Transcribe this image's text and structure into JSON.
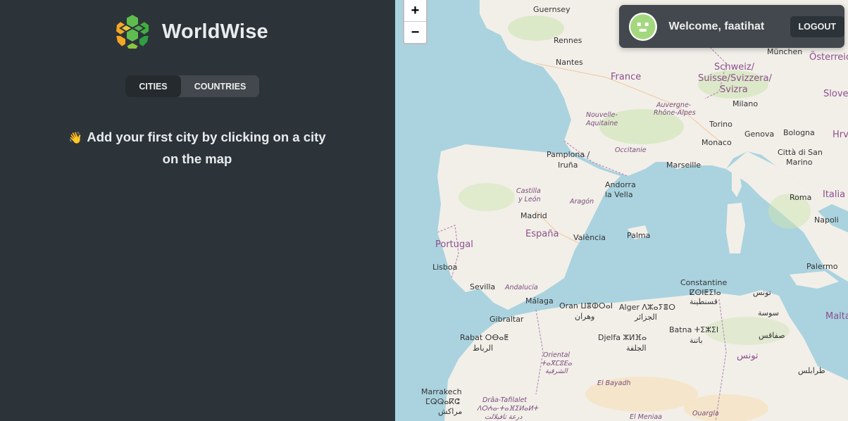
{
  "app": {
    "name": "WorldWise"
  },
  "tabs": [
    {
      "label": "Cities",
      "active": true
    },
    {
      "label": "Countries",
      "active": false
    }
  ],
  "message": {
    "emoji": "👋",
    "text": "Add your first city by clicking on a city on the map"
  },
  "map": {
    "zoom_in_label": "+",
    "zoom_out_label": "−",
    "labels": [
      {
        "text": "Guernsey",
        "kind": "city"
      },
      {
        "text": "Rennes",
        "kind": "city"
      },
      {
        "text": "Nantes",
        "kind": "city"
      },
      {
        "text": "France",
        "kind": "country"
      },
      {
        "text": "München",
        "kind": "city"
      },
      {
        "text": "Österreich",
        "kind": "country"
      },
      {
        "text": "Schweiz/",
        "kind": "country"
      },
      {
        "text": "Suisse/Svizzera/",
        "kind": "country"
      },
      {
        "text": "Svizra",
        "kind": "country"
      },
      {
        "text": "Slovenija",
        "kind": "country"
      },
      {
        "text": "Milano",
        "kind": "city"
      },
      {
        "text": "Auvergne-",
        "kind": "region"
      },
      {
        "text": "Rhône-Alpes",
        "kind": "region"
      },
      {
        "text": "Nouvelle-",
        "kind": "region"
      },
      {
        "text": "Aquitaine",
        "kind": "region"
      },
      {
        "text": "Torino",
        "kind": "city"
      },
      {
        "text": "Genova",
        "kind": "city"
      },
      {
        "text": "Bologna",
        "kind": "city"
      },
      {
        "text": "Hrvatska",
        "kind": "country"
      },
      {
        "text": "Monaco",
        "kind": "city"
      },
      {
        "text": "Occitanie",
        "kind": "region"
      },
      {
        "text": "Pamplona /",
        "kind": "city"
      },
      {
        "text": "Iruña",
        "kind": "city"
      },
      {
        "text": "Marseille",
        "kind": "city"
      },
      {
        "text": "Città di San",
        "kind": "city"
      },
      {
        "text": "Marino",
        "kind": "city"
      },
      {
        "text": "Andorra",
        "kind": "city"
      },
      {
        "text": "la Vella",
        "kind": "city"
      },
      {
        "text": "Castilla",
        "kind": "region"
      },
      {
        "text": "y León",
        "kind": "region"
      },
      {
        "text": "Aragón",
        "kind": "region"
      },
      {
        "text": "Italia",
        "kind": "country"
      },
      {
        "text": "Roma",
        "kind": "city"
      },
      {
        "text": "Madrid",
        "kind": "city"
      },
      {
        "text": "España",
        "kind": "country"
      },
      {
        "text": "València",
        "kind": "city"
      },
      {
        "text": "Palma",
        "kind": "city"
      },
      {
        "text": "Napoli",
        "kind": "city"
      },
      {
        "text": "Portugal",
        "kind": "country"
      },
      {
        "text": "Lisboa",
        "kind": "city"
      },
      {
        "text": "Palermo",
        "kind": "city"
      },
      {
        "text": "Constantine",
        "kind": "city"
      },
      {
        "text": "ⵇⵙⵏⵟⵉⵏⴰ",
        "kind": "city"
      },
      {
        "text": "قسنطينة",
        "kind": "city"
      },
      {
        "text": "Sevilla",
        "kind": "city"
      },
      {
        "text": "Andalucía",
        "kind": "region"
      },
      {
        "text": "تونس",
        "kind": "city"
      },
      {
        "text": "Málaga",
        "kind": "city"
      },
      {
        "text": "Oran ⵡⴻⵀⵔⴰⵏ",
        "kind": "city"
      },
      {
        "text": "وهران",
        "kind": "city"
      },
      {
        "text": "Alger ⴷⵣⴰⵢⴻⵔ",
        "kind": "city"
      },
      {
        "text": "الجزائر",
        "kind": "city"
      },
      {
        "text": "سوسة",
        "kind": "city"
      },
      {
        "text": "Malta",
        "kind": "country"
      },
      {
        "text": "Gibraltar",
        "kind": "city"
      },
      {
        "text": "Batna ⵜⵉⵣⵉⵏ",
        "kind": "city"
      },
      {
        "text": "باتنة",
        "kind": "city"
      },
      {
        "text": "صفاقس",
        "kind": "city"
      },
      {
        "text": "Rabat ⵔⴱⴰⵟ",
        "kind": "city"
      },
      {
        "text": "الرباط",
        "kind": "city"
      },
      {
        "text": "Djelfa ⵣⵍⴼⴰ",
        "kind": "city"
      },
      {
        "text": "الجلفة",
        "kind": "city"
      },
      {
        "text": "Oriental",
        "kind": "region"
      },
      {
        "text": "ⵜⴰⴳⵎⵓⴹⴰ",
        "kind": "region"
      },
      {
        "text": "الشرقية",
        "kind": "region"
      },
      {
        "text": "تونس",
        "kind": "country"
      },
      {
        "text": "El Bayadh",
        "kind": "region"
      },
      {
        "text": "طرابلس",
        "kind": "city"
      },
      {
        "text": "Marrakech",
        "kind": "city"
      },
      {
        "text": "ⵎⵕⵕⴰⴽⵛ",
        "kind": "city"
      },
      {
        "text": "مراكش",
        "kind": "city"
      },
      {
        "text": "Drâa-Tafilalet",
        "kind": "region"
      },
      {
        "text": "ⴷⵔⵄⴰ-ⵜⴰⴼⵉⵍⴰⵍⵜ",
        "kind": "region"
      },
      {
        "text": "درعة تافيلالت",
        "kind": "region"
      },
      {
        "text": "El Meniaa",
        "kind": "region"
      },
      {
        "text": "Ouargla",
        "kind": "region"
      }
    ]
  },
  "user": {
    "welcome": "Welcome, faatihat",
    "logout_label": "Logout"
  },
  "colors": {
    "sidebar_bg": "#2d3439",
    "tab_bg": "#42484d",
    "tab_active_bg": "#242a2e",
    "sea": "#aad3df",
    "land": "#f2efe9",
    "forest": "#cde5b2",
    "brand_green": "#00c46a",
    "brand_orange": "#ffb545"
  }
}
